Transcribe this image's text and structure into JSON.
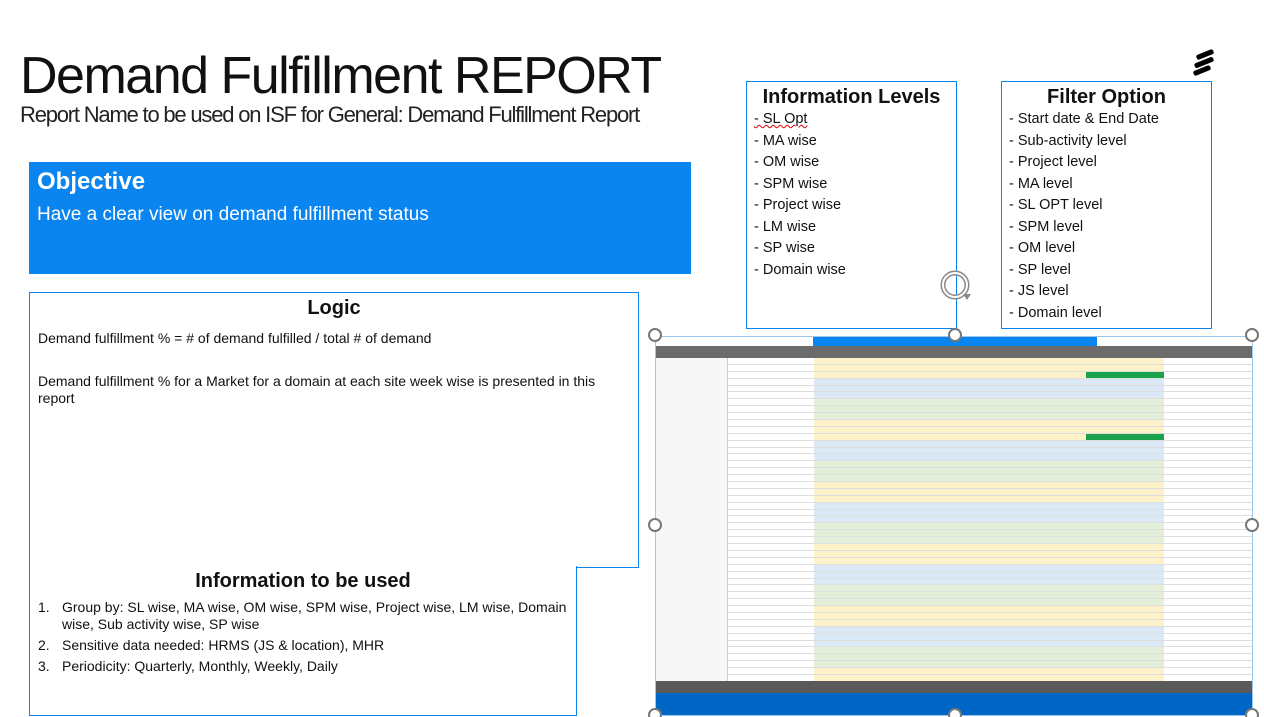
{
  "header": {
    "title": "Demand Fulfillment REPORT",
    "subtitle": "Report Name to be used on ISF for General: Demand Fulfillment Report"
  },
  "objective": {
    "heading": "Objective",
    "text": "Have a clear view on demand fulfillment status"
  },
  "logic": {
    "heading": "Logic",
    "line1": "Demand fulfillment % =  # of demand fulfilled / total # of demand",
    "line2": "Demand fulfillment % for a Market for a domain at each site week wise is presented in this report"
  },
  "info_used": {
    "heading": "Information to be used",
    "items": [
      {
        "num": "1.",
        "text": "Group by: SL wise, MA wise, OM wise, SPM wise, Project wise, LM wise, Domain wise, Sub activity wise, SP wise"
      },
      {
        "num": "2.",
        "text": "Sensitive data needed: HRMS (JS & location), MHR"
      },
      {
        "num": "3.",
        "text": "Periodicity: Quarterly, Monthly, Weekly, Daily"
      }
    ]
  },
  "info_levels": {
    "heading": "Information Levels",
    "items": [
      "- SL Opt",
      "- MA wise",
      "- OM wise",
      "- SPM wise",
      "- Project wise",
      "- LM wise",
      "- SP wise",
      "- Domain wise"
    ]
  },
  "filter_option": {
    "heading": "Filter Option",
    "items": [
      "- Start date & End Date",
      "- Sub-activity level",
      "- Project level",
      "- MA level",
      "- SL OPT level",
      "- SPM level",
      "- OM level",
      "- SP level",
      "- JS level",
      "- Domain level"
    ]
  },
  "colors": {
    "accent": "#0a84ef",
    "footer_blue": "#0066c5"
  }
}
